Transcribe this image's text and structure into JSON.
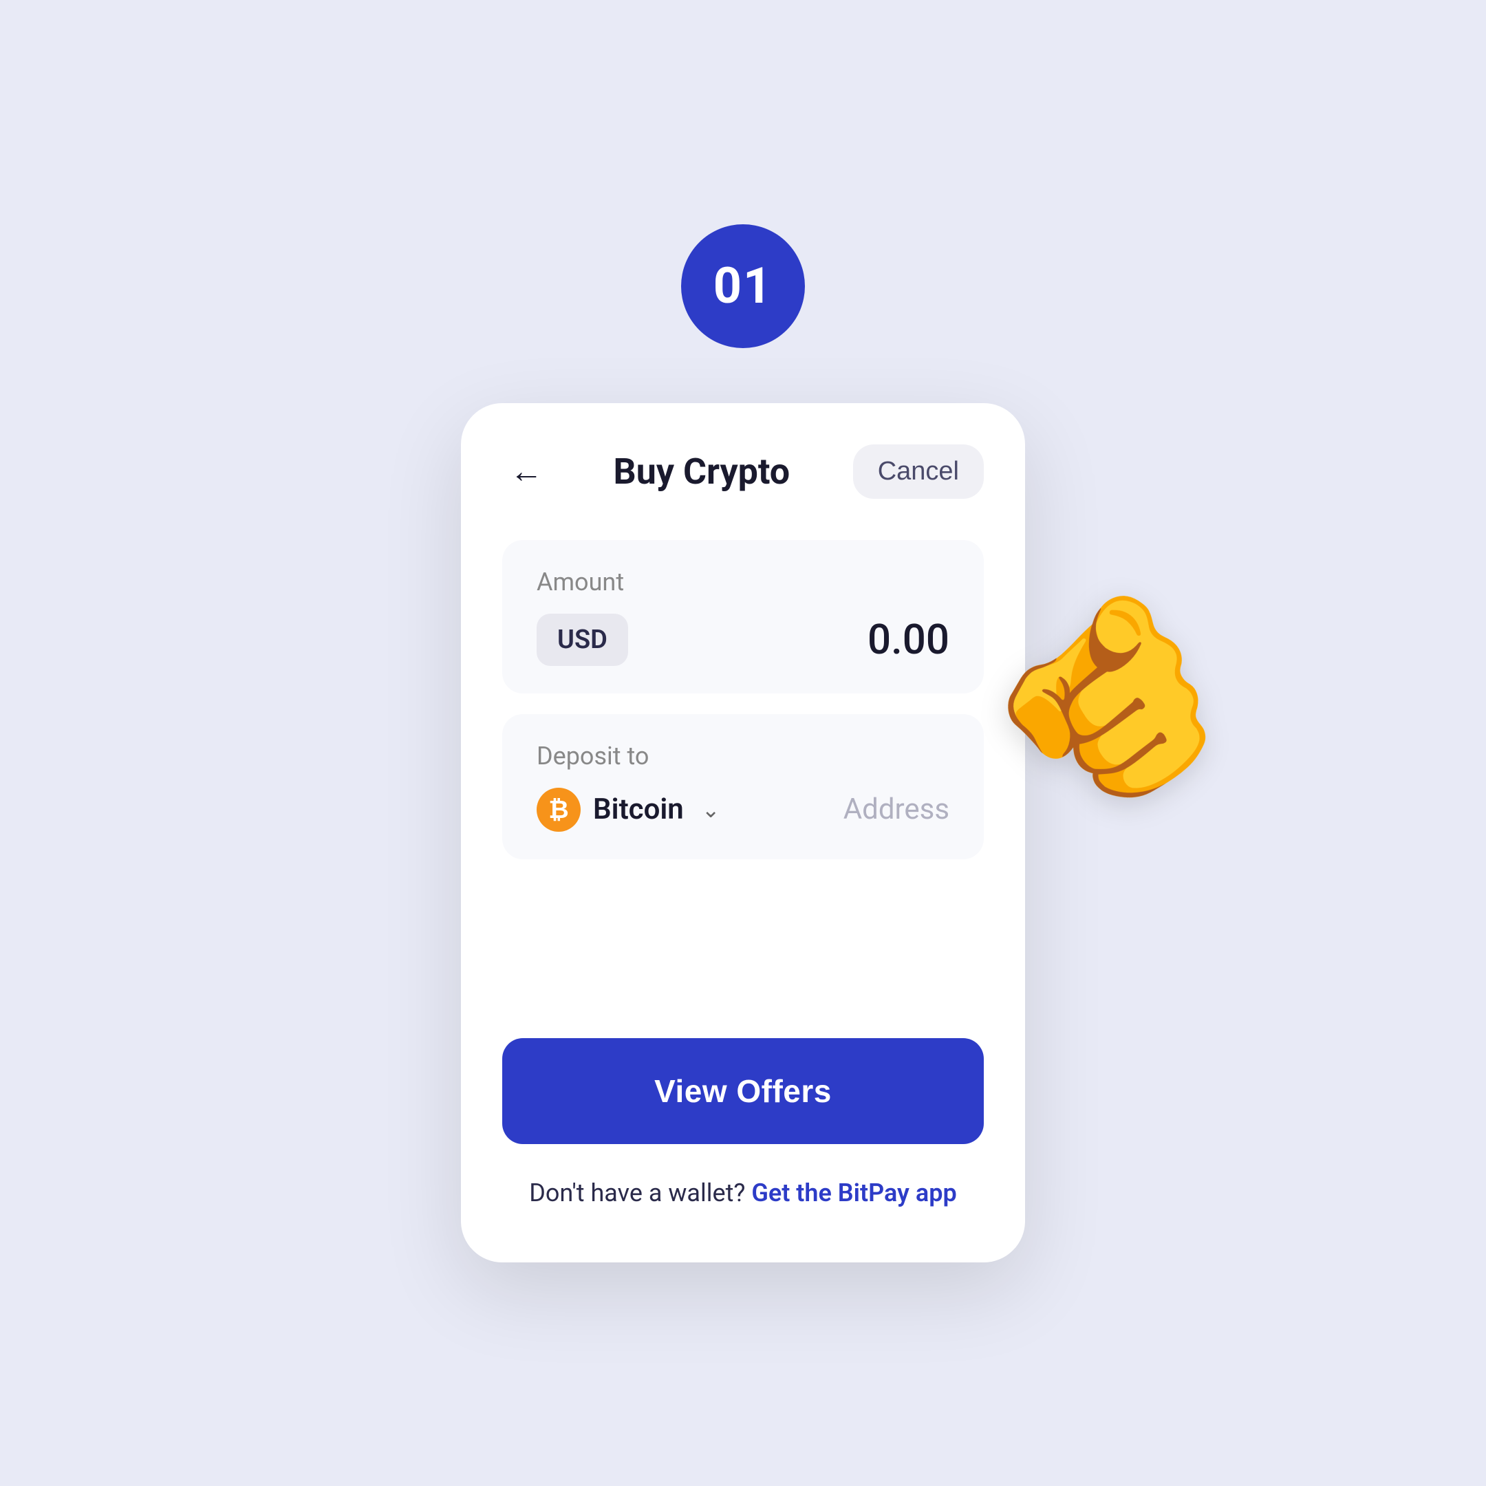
{
  "page": {
    "background_color": "#e8eaf6",
    "step_number": "01",
    "step_badge_color": "#2d3cc7"
  },
  "header": {
    "title": "Buy Crypto",
    "cancel_label": "Cancel",
    "back_label": "←"
  },
  "amount_section": {
    "label": "Amount",
    "currency": "USD",
    "value": "0.00"
  },
  "deposit_section": {
    "label": "Deposit to",
    "coin_name": "Bitcoin",
    "coin_symbol": "₿",
    "address_placeholder": "Address"
  },
  "actions": {
    "view_offers_label": "View Offers",
    "wallet_prompt": "Don't have a wallet?",
    "wallet_link": "Get the BitPay app"
  }
}
